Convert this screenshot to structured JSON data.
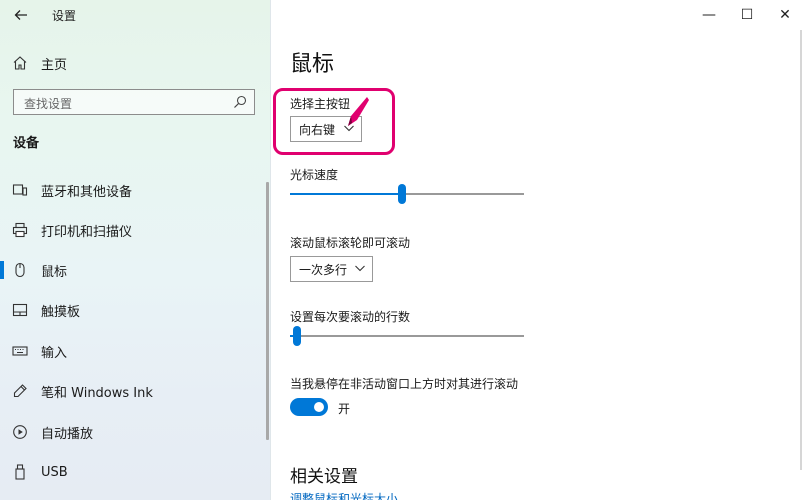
{
  "window": {
    "title": "设置",
    "back_icon": "arrow-left-icon",
    "controls": {
      "minimize": "—",
      "maximize": "☐",
      "close": "✕"
    }
  },
  "sidebar": {
    "home_label": "主页",
    "search_placeholder": "查找设置",
    "section_title": "设备",
    "items": [
      {
        "label": "蓝牙和其他设备",
        "icon": "bluetooth-devices-icon"
      },
      {
        "label": "打印机和扫描仪",
        "icon": "printer-icon"
      },
      {
        "label": "鼠标",
        "icon": "mouse-icon",
        "active": true
      },
      {
        "label": "触摸板",
        "icon": "touchpad-icon"
      },
      {
        "label": "输入",
        "icon": "keyboard-icon"
      },
      {
        "label": "笔和 Windows Ink",
        "icon": "pen-icon"
      },
      {
        "label": "自动播放",
        "icon": "autoplay-icon"
      },
      {
        "label": "USB",
        "icon": "usb-icon"
      }
    ]
  },
  "main": {
    "title": "鼠标",
    "primary_button": {
      "label": "选择主按钮",
      "value": "向右键"
    },
    "cursor_speed": {
      "label": "光标速度",
      "level": 0.48
    },
    "scroll_mode": {
      "label": "滚动鼠标滚轮即可滚动",
      "value": "一次多行"
    },
    "lines_per_scroll": {
      "label": "设置每次要滚动的行数",
      "level": 0.03
    },
    "inactive_scroll": {
      "label": "当我悬停在非活动窗口上方时对其进行滚动",
      "state": "开",
      "on": true
    },
    "related_title": "相关设置",
    "related_link": "调整鼠标和光标大小"
  },
  "colors": {
    "accent": "#0078d7",
    "highlight": "#e0006f"
  }
}
